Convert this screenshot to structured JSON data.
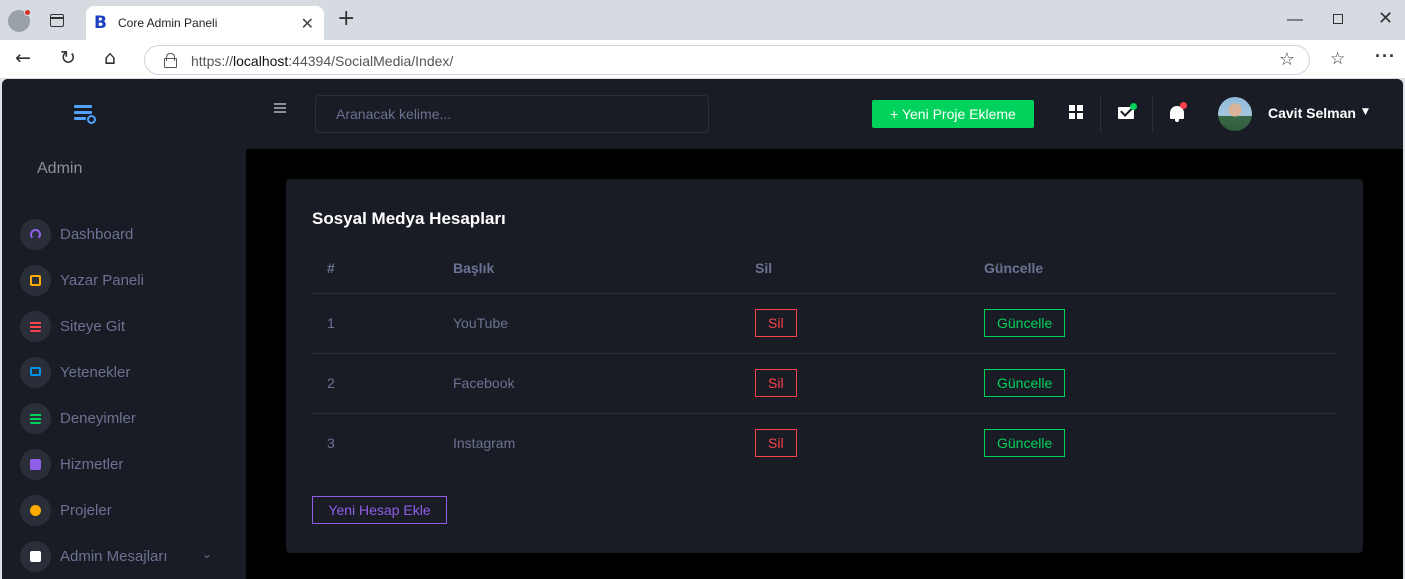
{
  "browser": {
    "tab_title": "Core Admin Paneli",
    "tab_favicon": "B",
    "url_prefix": "https://",
    "url_host": "localhost",
    "url_rest": ":44394/SocialMedia/Index/"
  },
  "sidebar": {
    "user_label": "Admin",
    "items": [
      {
        "label": "Dashboard",
        "icon": "speedometer-icon",
        "color": "#8f5fe8"
      },
      {
        "label": "Yazar Paneli",
        "icon": "chat-alert-icon",
        "color": "#ffab00"
      },
      {
        "label": "Siteye Git",
        "icon": "table-icon",
        "color": "#fc424a"
      },
      {
        "label": "Yetenekler",
        "icon": "laptop-icon",
        "color": "#0090e7"
      },
      {
        "label": "Deneyimler",
        "icon": "playlist-icon",
        "color": "#00d25b"
      },
      {
        "label": "Hizmetler",
        "icon": "contacts-icon",
        "color": "#8f5fe8"
      },
      {
        "label": "Projeler",
        "icon": "github-icon",
        "color": "#ffab00"
      },
      {
        "label": "Admin Mesajları",
        "icon": "message-icon",
        "color": "#ffffff"
      }
    ]
  },
  "topnav": {
    "search_placeholder": "Aranacak kelime...",
    "new_project_label": "+ Yeni Proje Ekleme",
    "user_name": "Cavit Selman"
  },
  "card": {
    "title": "Sosyal Medya Hesapları",
    "columns": [
      "#",
      "Başlık",
      "Sil",
      "Güncelle"
    ],
    "rows": [
      {
        "id": "1",
        "title": "YouTube",
        "delete_label": "Sil",
        "update_label": "Güncelle"
      },
      {
        "id": "2",
        "title": "Facebook",
        "delete_label": "Sil",
        "update_label": "Güncelle"
      },
      {
        "id": "3",
        "title": "Instagram",
        "delete_label": "Sil",
        "update_label": "Güncelle"
      }
    ],
    "add_label": "Yeni Hesap Ekle"
  },
  "colors": {
    "bg_dark": "#191c24",
    "success": "#00d25b",
    "danger": "#fc424a",
    "primary": "#8f5fe8"
  }
}
